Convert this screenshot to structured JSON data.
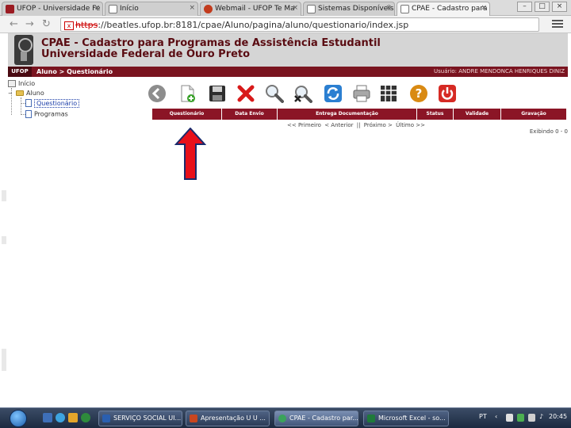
{
  "browser": {
    "tabs": [
      {
        "label": "UFOP - Universidade Fe",
        "active": false
      },
      {
        "label": "Início",
        "active": false
      },
      {
        "label": "Webmail - UFOP Te Ma",
        "active": false
      },
      {
        "label": "Sistemas Disponíveis - C",
        "active": false
      },
      {
        "label": "CPAE - Cadastro para P",
        "active": true
      }
    ],
    "tab_close_glyph": "×",
    "window_controls": [
      "–",
      "□",
      "×"
    ],
    "url_scheme": "https",
    "url_rest": "://beatles.ufop.br:8181/cpae/Aluno/pagina/aluno/questionario/index.jsp",
    "back_icon": "back-arrow-icon",
    "forward_icon": "forward-arrow-icon",
    "reload_icon": "reload-icon"
  },
  "app": {
    "title": "CPAE - Cadastro para Programas de Assistência Estudantil",
    "subtitle": "Universidade Federal de Ouro Preto",
    "badge": "UFOP",
    "breadcrumb": "Aluno > Questionário",
    "user": "Usuário: ANDRE MENDONCA HENRIQUES DINIZ"
  },
  "tree": {
    "root": "Início",
    "folder": "Aluno",
    "items": [
      "Questionário",
      "Programas"
    ]
  },
  "toolbar": {
    "buttons": [
      "back-icon",
      "new-document-icon",
      "save-disk-icon",
      "delete-x-icon",
      "search-magnifier-icon",
      "clear-search-icon",
      "refresh-icon",
      "print-icon",
      "grid-columns-icon",
      "help-icon",
      "power-exit-icon"
    ]
  },
  "grid": {
    "columns": [
      "Questionário",
      "Data Envio",
      "Entrega Documentação",
      "Status",
      "Validade",
      "Gravação"
    ]
  },
  "pager": {
    "first": "<< Primeiro",
    "prev": "< Anterior",
    "sep": "||",
    "next": "Próximo >",
    "last": "Último >>",
    "count": "Exibindo 0 - 0"
  },
  "taskbar": {
    "buttons": [
      {
        "label": "SERVIÇO SOCIAL UI...",
        "active": false
      },
      {
        "label": "Apresentação U U ...",
        "active": false
      },
      {
        "label": "CPAE - Cadastro par...",
        "active": true
      },
      {
        "label": "Microsoft Excel - so...",
        "active": false
      }
    ],
    "lang": "PT",
    "clock": "20:45"
  },
  "colors": {
    "brand_dark": "#5a0c12",
    "brand_red": "#8b1526",
    "arrow_red": "#e8101a",
    "arrow_outline": "#1a2a6c"
  }
}
